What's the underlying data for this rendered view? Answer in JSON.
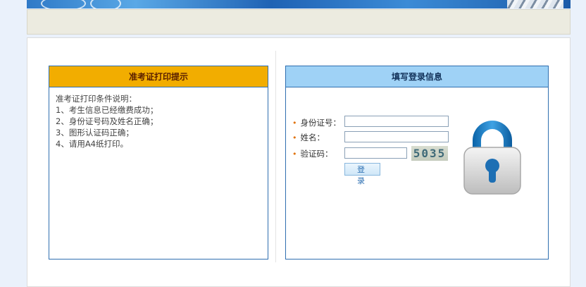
{
  "left_panel": {
    "title": "准考证打印提示",
    "lines": [
      "准考证打印条件说明：",
      "1、考生信息已经缴费成功；",
      "2、身份证号码及姓名正确；",
      "3、图形认证码正确；",
      "4、请用A4纸打印。"
    ]
  },
  "right_panel": {
    "title": "填写登录信息",
    "id_label": "身份证号：",
    "id_value": "",
    "name_label": "姓名：",
    "name_value": "",
    "captcha_label": "验证码：",
    "captcha_value": "",
    "captcha_code": "5035",
    "login_button": "登 录",
    "bullet": "•"
  },
  "icons": {
    "lock": "lock-icon"
  },
  "colors": {
    "left_header": "#f2ad00",
    "right_header": "#9fd2f6",
    "panel_border": "#2f6fb0",
    "page_bg": "#eaf1fb"
  }
}
